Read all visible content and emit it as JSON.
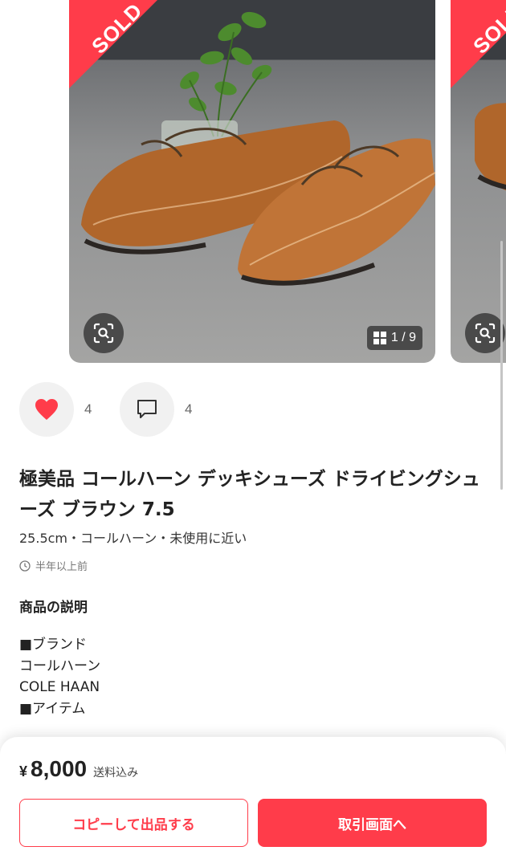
{
  "carousel": {
    "sold_label": "SOLD",
    "counter": "1 / 9"
  },
  "actions": {
    "like_count": "4",
    "comment_count": "4"
  },
  "item": {
    "title": "極美品 コールハーン デッキシューズ ドライビングシューズ ブラウン 7.5",
    "subtitle": "25.5cm・コールハーン・未使用に近い",
    "posted": "半年以上前"
  },
  "description": {
    "heading": "商品の説明",
    "lines": [
      "■ブランド",
      "コールハーン",
      "COLE HAAN",
      "",
      "■アイテム"
    ]
  },
  "purchase": {
    "yen": "¥",
    "price": "8,000",
    "shipping": "送料込み",
    "copy_button": "コピーして出品する",
    "trade_button": "取引画面へ"
  },
  "colors": {
    "accent": "#ff3c4a"
  }
}
